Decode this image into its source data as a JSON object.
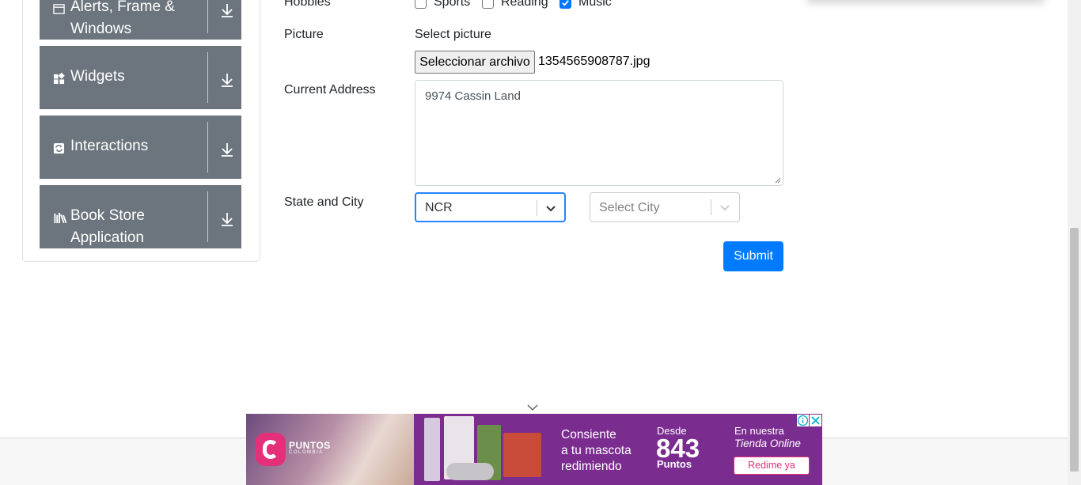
{
  "sidebar": {
    "groups": [
      {
        "label_line1": "Alerts, Frame &",
        "label_line2": "Windows",
        "icon": "window-icon"
      },
      {
        "label": "Widgets",
        "icon": "widgets-icon"
      },
      {
        "label": "Interactions",
        "icon": "interactions-icon"
      },
      {
        "label_line1": "Book Store",
        "label_line2": "Application",
        "icon": "book-icon"
      }
    ]
  },
  "form": {
    "hobbies_label": "Hobbies",
    "hobbies": [
      {
        "label": "Sports",
        "checked": false
      },
      {
        "label": "Reading",
        "checked": false
      },
      {
        "label": "Music",
        "checked": true
      }
    ],
    "picture_label": "Picture",
    "picture_prompt": "Select picture",
    "file_button": "Seleccionar archivo",
    "file_name": "1354565908787.jpg",
    "address_label": "Current Address",
    "address_value": "9974 Cassin Land",
    "state_city_label": "State and City",
    "state_value": "NCR",
    "city_placeholder": "Select City",
    "submit_label": "Submit"
  },
  "ad": {
    "brand": "PUNTOS",
    "brand_sub": "COLOMBIA",
    "line1": "Consiente",
    "line2": "a tu mascota",
    "line3": "redimiendo",
    "desde": "Desde",
    "number": "843",
    "puntos": "Puntos",
    "en_nuestra": "En nuestra",
    "tienda": "Tienda Online",
    "cta": "Redime ya",
    "colors": {
      "purple": "#7b2c8f",
      "pink": "#e4307a"
    }
  }
}
